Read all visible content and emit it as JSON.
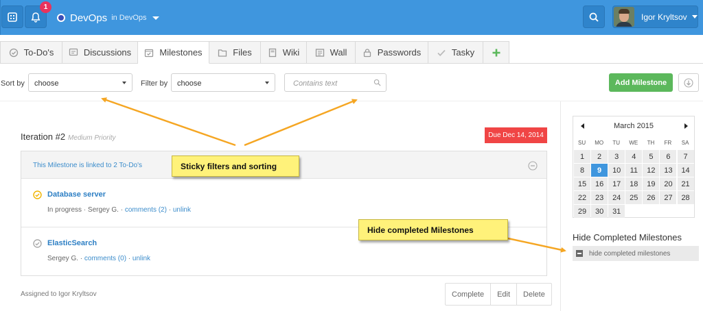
{
  "topbar": {
    "notification_count": "1",
    "project_name": "DevOps",
    "project_sub": "in DevOps",
    "user_name": "Igor Kryltsov",
    "icons": [
      "apps-icon",
      "bell-icon",
      "search-icon"
    ],
    "colors": {
      "bar": "#3f96de",
      "badge": "#e8335d"
    }
  },
  "tabs": [
    {
      "label": "To-Do's",
      "icon": "check-circle-icon"
    },
    {
      "label": "Discussions",
      "icon": "comment-icon"
    },
    {
      "label": "Milestones",
      "icon": "calendar-check-icon",
      "active": true
    },
    {
      "label": "Files",
      "icon": "folder-icon"
    },
    {
      "label": "Wiki",
      "icon": "book-icon"
    },
    {
      "label": "Wall",
      "icon": "newspaper-icon"
    },
    {
      "label": "Passwords",
      "icon": "lock-icon"
    },
    {
      "label": "Tasky",
      "icon": "checkmark-icon"
    },
    {
      "label": "",
      "icon": "plus-icon"
    }
  ],
  "filters": {
    "sort_label": "Sort by",
    "sort_value": "choose",
    "filter_label": "Filter by",
    "filter_value": "choose",
    "search_placeholder": "Contains text",
    "add_button": "Add Milestone"
  },
  "milestone": {
    "title": "Iteration #2",
    "priority": "Medium Priority",
    "due": "Due Dec 14, 2014",
    "linked_text": "This Milestone is linked to 2 To-Do's",
    "items": [
      {
        "name": "Database server",
        "status": "In progress · Sergey G. · ",
        "comments": "comments (2)",
        "sep": " · ",
        "unlink": "unlink",
        "icon_color": "#f0b400"
      },
      {
        "name": "ElasticSearch",
        "status": "Sergey G. · ",
        "comments": "comments (0)",
        "sep": " · ",
        "unlink": "unlink",
        "icon_color": "#aaaaaa"
      }
    ],
    "assigned": "Assigned to Igor Kryltsov",
    "actions": [
      "Complete",
      "Edit",
      "Delete"
    ]
  },
  "calendar": {
    "month": "March 2015",
    "dows": [
      "SU",
      "MO",
      "TU",
      "WE",
      "TH",
      "FR",
      "SA"
    ],
    "days": [
      "1",
      "2",
      "3",
      "4",
      "5",
      "6",
      "7",
      "8",
      "9",
      "10",
      "11",
      "12",
      "13",
      "14",
      "15",
      "16",
      "17",
      "18",
      "19",
      "20",
      "21",
      "22",
      "23",
      "24",
      "25",
      "26",
      "27",
      "28",
      "29",
      "30",
      "31"
    ],
    "today": "9"
  },
  "hide_panel": {
    "title": "Hide Completed Milestones",
    "checkbox_label": "hide completed milestones"
  },
  "callouts": {
    "filters": "Sticky filters and sorting",
    "hide": "Hide completed Milestones",
    "color": "#fff27a",
    "arrow_color": "#f5a623"
  }
}
